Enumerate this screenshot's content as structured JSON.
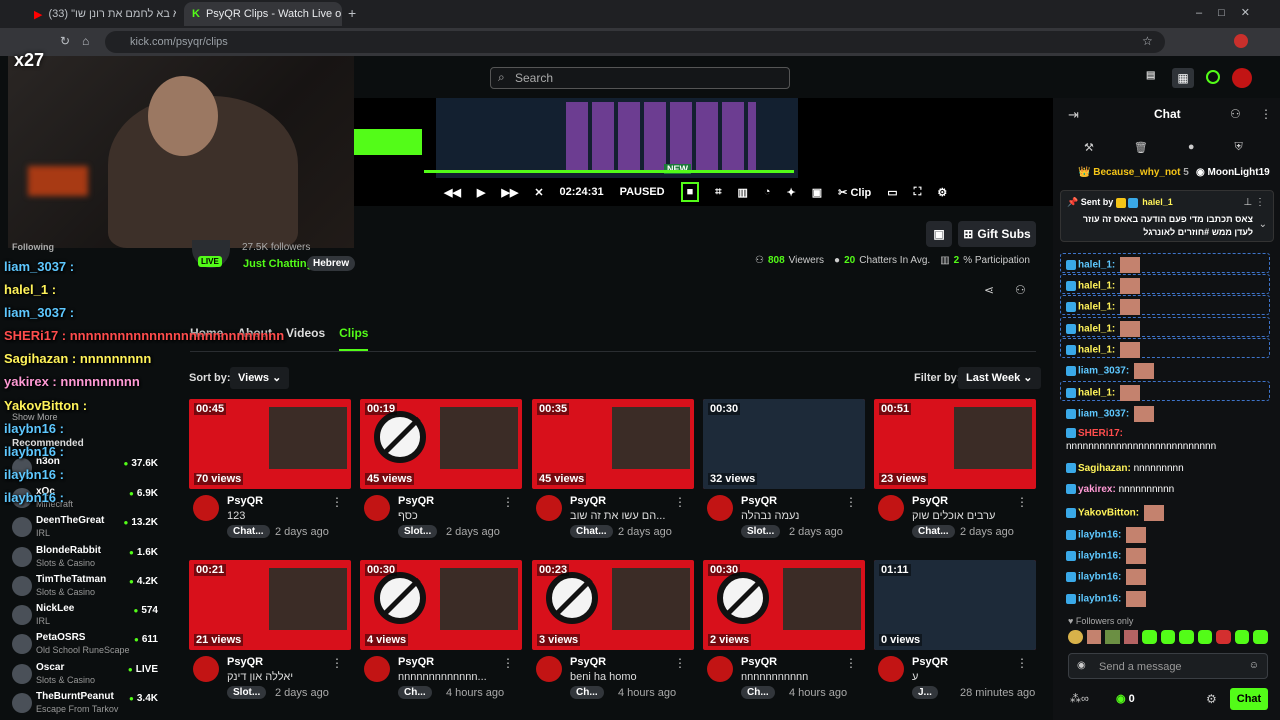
{
  "browser": {
    "tabs": [
      {
        "title": "(33) \"הוא בא לחמם את רונן שו"
      },
      {
        "title": "PsyQR Clips - Watch Live on Ki"
      }
    ],
    "url": "kick.com/psyqr/clips"
  },
  "header": {
    "search_placeholder": "Search"
  },
  "player": {
    "time": "02:24:31",
    "status": "PAUSED",
    "clip_label": "Clip",
    "new_label": "NEW"
  },
  "stream_overlay": {
    "cam_label": "x27"
  },
  "channel": {
    "followers_label": "27.5K followers",
    "live_badge": "LIVE",
    "category": "Just Chatting",
    "language": "Hebrew",
    "gift_button": "Gift Subs",
    "viewers": "808",
    "viewers_label": "Viewers",
    "chatters": "20",
    "chatters_label": "Chatters In Avg.",
    "participation": "2",
    "participation_label": "% Participation"
  },
  "tabs": [
    "Home",
    "About",
    "Videos",
    "Clips"
  ],
  "filters": {
    "sort_label": "Sort by:",
    "sort_value": "Views",
    "filter_label": "Filter by:",
    "filter_value": "Last Week"
  },
  "clips": [
    {
      "duration": "00:45",
      "views": "70 views",
      "channel": "PsyQR",
      "title": "123",
      "category": "Chat...",
      "ago": "2 days ago"
    },
    {
      "duration": "00:19",
      "views": "45 views",
      "channel": "PsyQR",
      "title": "כסף",
      "category": "Slot...",
      "ago": "2 days ago"
    },
    {
      "duration": "00:35",
      "views": "45 views",
      "channel": "PsyQR",
      "title": "הם עשו את זה שוב...",
      "category": "Chat...",
      "ago": "2 days ago"
    },
    {
      "duration": "00:30",
      "views": "32 views",
      "channel": "PsyQR",
      "title": "נעמה נבהלה",
      "category": "Slot...",
      "ago": "2 days ago"
    },
    {
      "duration": "00:51",
      "views": "23 views",
      "channel": "PsyQR",
      "title": "ערבים אוכלים שוק",
      "category": "Chat...",
      "ago": "2 days ago"
    },
    {
      "duration": "00:21",
      "views": "21 views",
      "channel": "PsyQR",
      "title": "יאללה און דינק",
      "category": "Slot...",
      "ago": "2 days ago"
    },
    {
      "duration": "00:30",
      "views": "4 views",
      "channel": "PsyQR",
      "title": "nnnnnnnnnnnnn...",
      "category": "Ch...",
      "ago": "4 hours ago"
    },
    {
      "duration": "00:23",
      "views": "3 views",
      "channel": "PsyQR",
      "title": "beni ha homo",
      "category": "Ch...",
      "ago": "4 hours ago"
    },
    {
      "duration": "00:30",
      "views": "2 views",
      "channel": "PsyQR",
      "title": "nnnnnnnnnnn",
      "category": "Ch...",
      "ago": "4 hours ago"
    },
    {
      "duration": "01:11",
      "views": "0 views",
      "channel": "PsyQR",
      "title": "ע",
      "category": "J...",
      "ago": "28 minutes ago"
    }
  ],
  "sidebar": {
    "following_label": "Following",
    "show_more": "Show More",
    "recommended_label": "Recommended",
    "recommended": [
      {
        "name": "n3on",
        "category": "",
        "viewers": "37.6K"
      },
      {
        "name": "xQc",
        "category": "Minecraft",
        "viewers": "6.9K"
      },
      {
        "name": "DeenTheGreat",
        "category": "IRL",
        "viewers": "13.2K"
      },
      {
        "name": "BlondeRabbit",
        "category": "Slots & Casino",
        "viewers": "1.6K"
      },
      {
        "name": "TimTheTatman",
        "category": "Slots & Casino",
        "viewers": "4.2K"
      },
      {
        "name": "NickLee",
        "category": "IRL",
        "viewers": "574"
      },
      {
        "name": "PetaOSRS",
        "category": "Old School RuneScape",
        "viewers": "611"
      },
      {
        "name": "Oscar",
        "category": "Slots & Casino",
        "viewers": "LIVE"
      },
      {
        "name": "TheBurntPeanut",
        "category": "Escape From Tarkov",
        "viewers": "3.4K"
      }
    ]
  },
  "overlay_chat": [
    {
      "text": "liam_3037 :",
      "color": "#5ec8ff"
    },
    {
      "text": "halel_1 :",
      "color": "#fff35a"
    },
    {
      "text": "liam_3037 :",
      "color": "#5ec8ff"
    },
    {
      "text": "SHERi17 : nnnnnnnnnnnnnnnnnnnnnnnnnnn",
      "color": "#ff4d4d"
    },
    {
      "text": "Sagihazan : nnnnnnnnn",
      "color": "#fff35a"
    },
    {
      "text": "yakirex : nnnnnnnnnn",
      "color": "#ff9ad5"
    },
    {
      "text": "YakovBitton :",
      "color": "#fff35a"
    },
    {
      "text": "ilaybn16 :",
      "color": "#5ec8ff"
    },
    {
      "text": "ilaybn16 :",
      "color": "#5ec8ff"
    },
    {
      "text": "ilaybn16 :",
      "color": "#5ec8ff"
    },
    {
      "text": "ilaybn16 :",
      "color": "#5ec8ff"
    }
  ],
  "chat": {
    "title": "Chat",
    "top_gifters": [
      {
        "name": "Because_why_not",
        "count": "5"
      },
      {
        "name": "MoonLight19",
        "count": ""
      }
    ],
    "pinned": {
      "sent_by": "Sent by",
      "user": "halel_1",
      "text": "צאס תכתבו מדי פעם הודעה באאס זה עוזר לעדן ממש #חוזרים לאונרגל"
    },
    "messages": [
      {
        "user": "halel_1:",
        "text": "",
        "color": "#5ec8ff"
      },
      {
        "user": "halel_1:",
        "text": "",
        "color": "#fff35a"
      },
      {
        "user": "halel_1:",
        "text": "",
        "color": "#fff35a"
      },
      {
        "user": "halel_1:",
        "text": "",
        "color": "#fff35a"
      },
      {
        "user": "halel_1:",
        "text": "",
        "color": "#fff35a"
      },
      {
        "user": "liam_3037:",
        "text": "",
        "color": "#5ec8ff"
      },
      {
        "user": "halel_1:",
        "text": "",
        "color": "#fff35a"
      },
      {
        "user": "liam_3037:",
        "text": "",
        "color": "#5ec8ff"
      },
      {
        "user": "SHERi17:",
        "text": "nnnnnnnnnnnnnnnnnnnnnnnnnnn",
        "color": "#ff4d4d"
      },
      {
        "user": "Sagihazan:",
        "text": "nnnnnnnnn",
        "color": "#fff35a"
      },
      {
        "user": "yakirex:",
        "text": "nnnnnnnnnn",
        "color": "#ff9ad5"
      },
      {
        "user": "YakovBitton:",
        "text": "",
        "color": "#fff35a"
      },
      {
        "user": "ilaybn16:",
        "text": "",
        "color": "#5ec8ff"
      },
      {
        "user": "ilaybn16:",
        "text": "",
        "color": "#5ec8ff"
      },
      {
        "user": "ilaybn16:",
        "text": "",
        "color": "#5ec8ff"
      },
      {
        "user": "ilaybn16:",
        "text": "",
        "color": "#5ec8ff"
      }
    ],
    "followers_only": "Followers only",
    "input_placeholder": "Send a message",
    "points": "0",
    "send_label": "Chat"
  },
  "colors": {
    "accent": "#53fc18",
    "clip_red": "#d8101b"
  }
}
